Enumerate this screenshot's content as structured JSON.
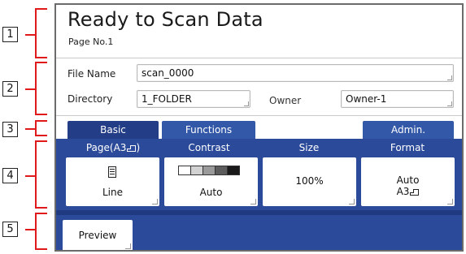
{
  "callouts": [
    "1",
    "2",
    "3",
    "4",
    "5"
  ],
  "header": {
    "title": "Ready to Scan Data",
    "page_no": "Page No.1"
  },
  "file_info": {
    "file_name_label": "File Name",
    "file_name_value": "scan_0000",
    "directory_label": "Directory",
    "directory_value": "1_FOLDER",
    "owner_label": "Owner",
    "owner_value": "Owner-1"
  },
  "tabs": [
    {
      "label": "Basic",
      "active": true
    },
    {
      "label": "Functions",
      "active": false
    },
    {
      "label": "Admin.",
      "active": false
    }
  ],
  "settings": {
    "page": {
      "label": "Page(A3",
      "value": "Line",
      "icon": "document-icon"
    },
    "contrast": {
      "label": "Contrast",
      "value": "Auto",
      "levels": [
        "#ffffff",
        "#d2d2d2",
        "#9a9a9a",
        "#5c5c5c",
        "#1a1a1a"
      ]
    },
    "size": {
      "label": "Size",
      "value": "100%"
    },
    "format": {
      "label": "Format",
      "value": "Auto",
      "paper": "A3"
    }
  },
  "preview_button": "Preview",
  "colors": {
    "tab_blue": "#3358a8",
    "panel_blue": "#2b4a99",
    "callout_red": "#e01a1a"
  }
}
